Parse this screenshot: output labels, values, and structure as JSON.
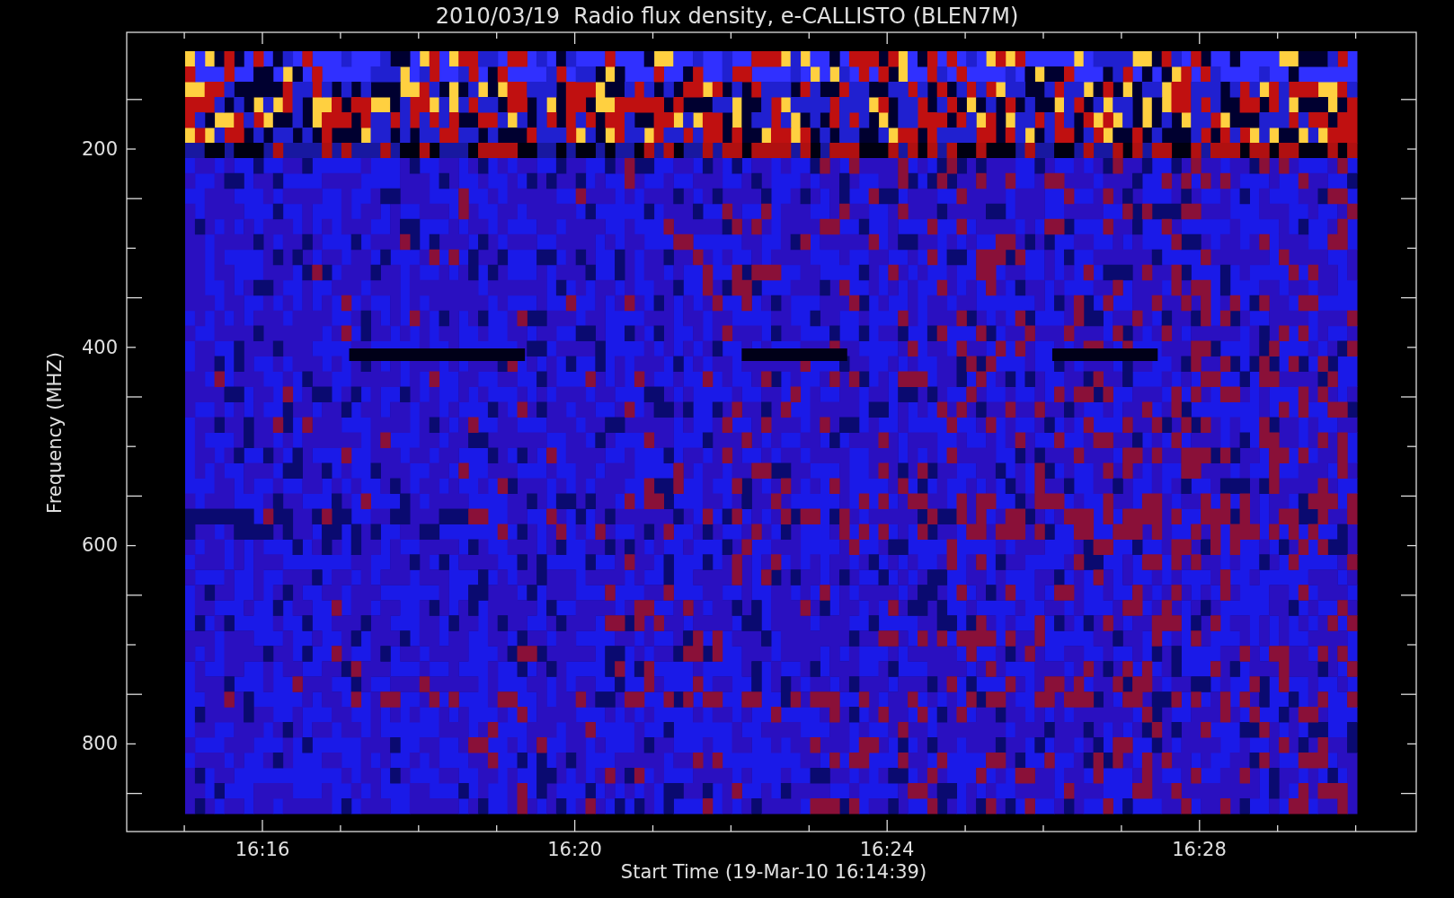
{
  "title": "2010/03/19  Radio flux density, e-CALLISTO (BLEN7M)",
  "x_axis": {
    "label": "Start Time (19-Mar-10 16:14:39)",
    "ticks": [
      "16:16",
      "16:20",
      "16:24",
      "16:28"
    ]
  },
  "y_axis": {
    "label": "Frequency (MHZ)",
    "ticks": [
      "200",
      "400",
      "600",
      "800"
    ]
  }
}
